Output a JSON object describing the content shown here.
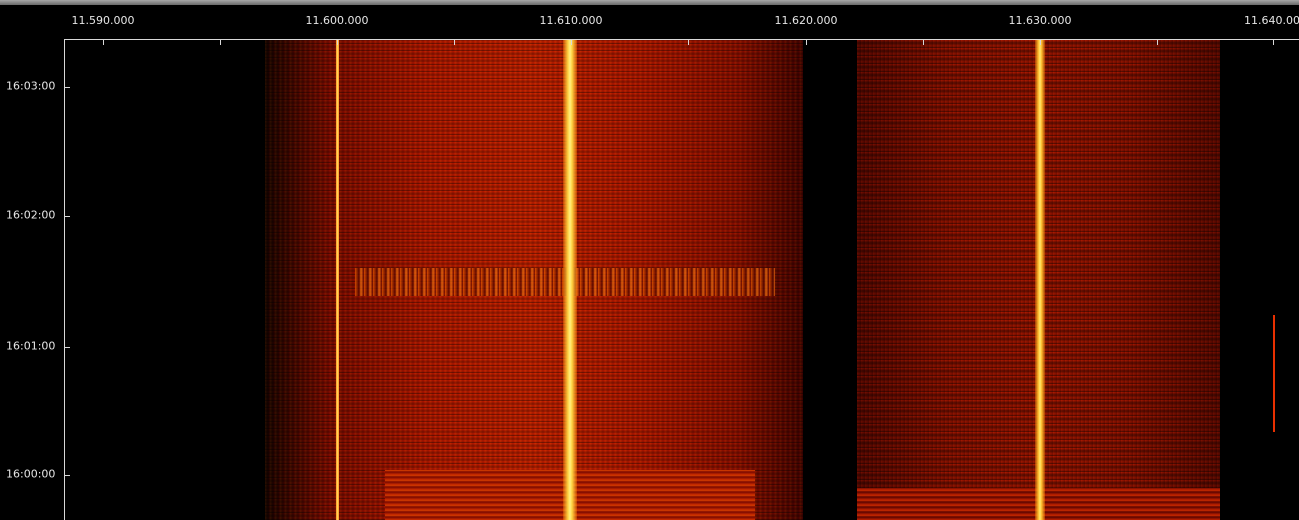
{
  "waterfall": {
    "frequency_axis": {
      "labels": [
        "11.590.000",
        "11.600.000",
        "11.610.000",
        "11.620.000",
        "11.630.000",
        "11.640.00"
      ]
    },
    "time_axis": {
      "labels": [
        "16:03:00",
        "16:02:00",
        "16:01:00",
        "16:00:00"
      ]
    },
    "colors": {
      "background": "#000000",
      "signal_low": "#5a0000",
      "signal_mid": "#e02000",
      "signal_high": "#ffe040"
    }
  }
}
